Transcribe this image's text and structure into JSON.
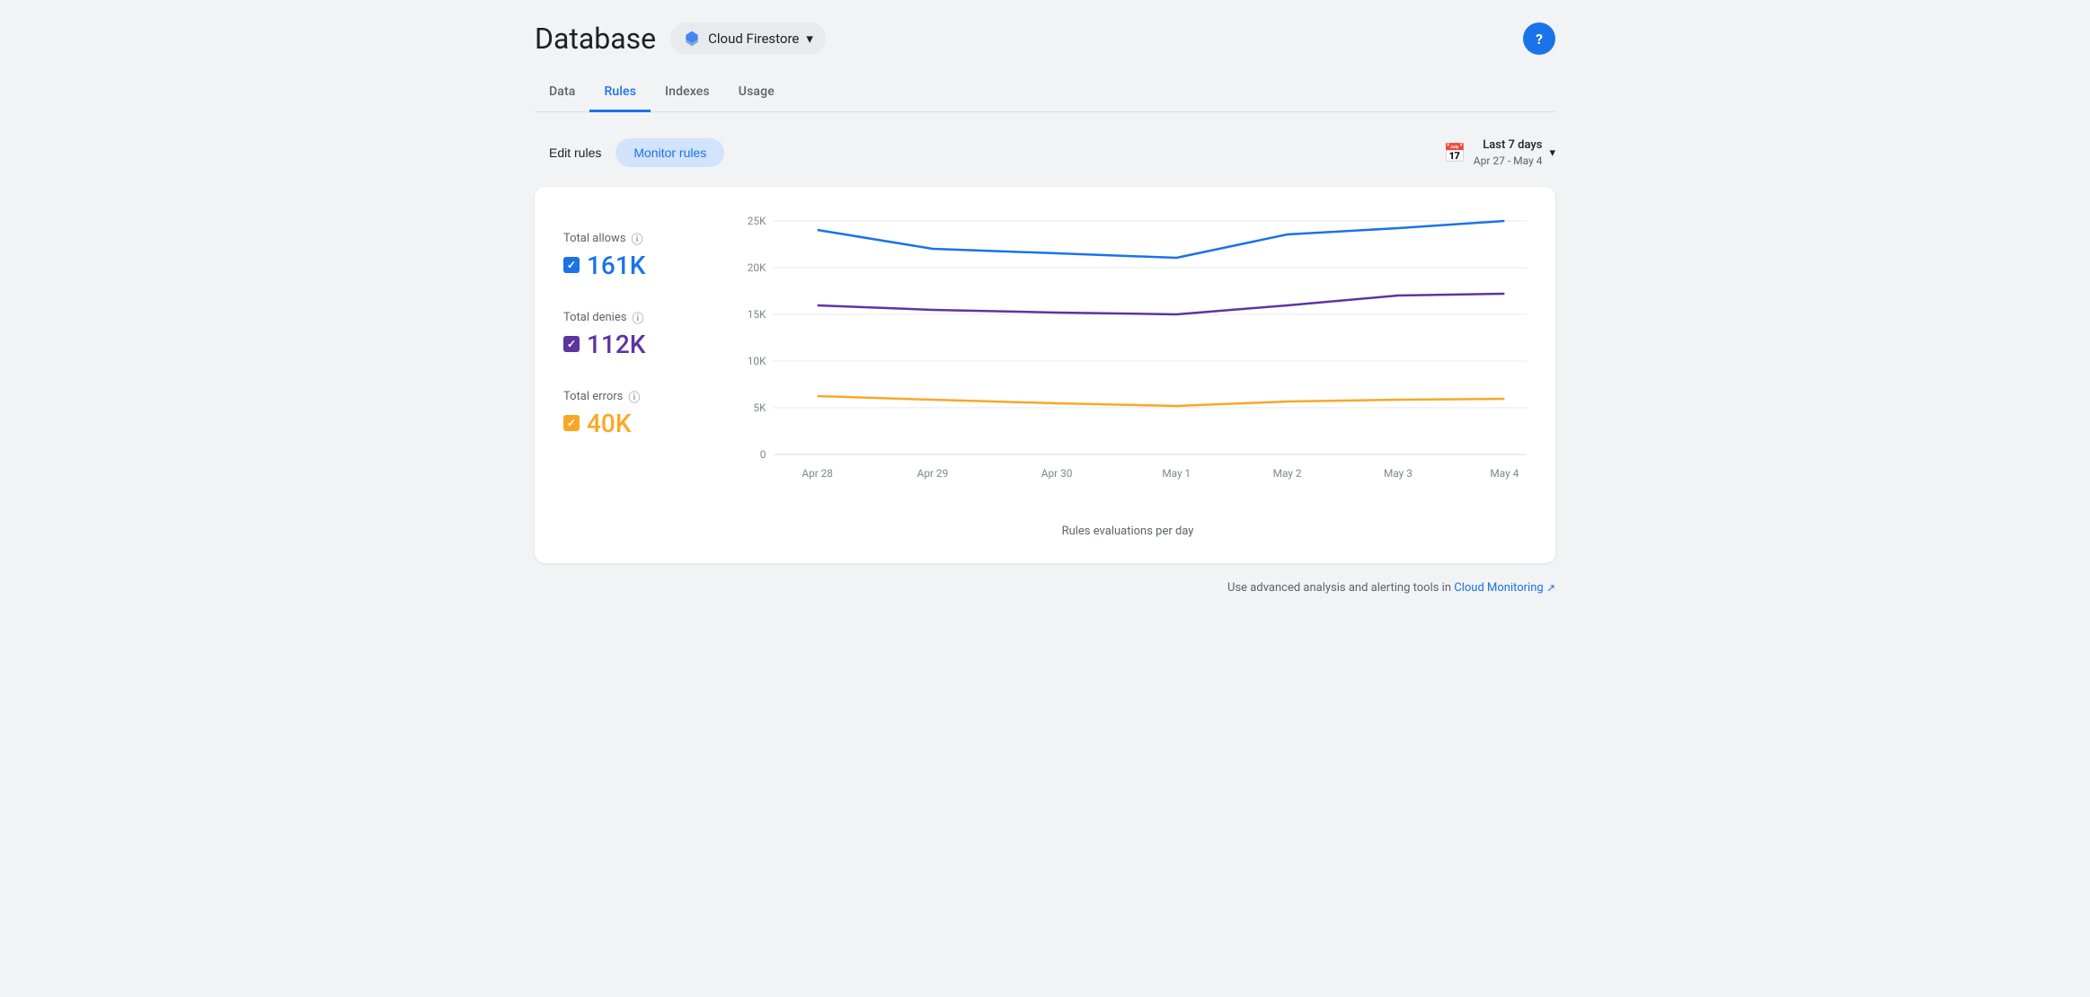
{
  "header": {
    "title": "Database",
    "product": "Cloud Firestore",
    "help_label": "?"
  },
  "nav": {
    "tabs": [
      {
        "label": "Data",
        "active": false
      },
      {
        "label": "Rules",
        "active": true
      },
      {
        "label": "Indexes",
        "active": false
      },
      {
        "label": "Usage",
        "active": false
      }
    ]
  },
  "toolbar": {
    "edit_rules_label": "Edit rules",
    "monitor_rules_label": "Monitor rules"
  },
  "date_range": {
    "label": "Last 7 days",
    "range": "Apr 27 - May 4"
  },
  "chart": {
    "title": "Rules evaluations per day",
    "metrics": [
      {
        "label": "Total allows",
        "value": "161K",
        "color": "blue",
        "color_hex": "#1a73e8"
      },
      {
        "label": "Total denies",
        "value": "112K",
        "color": "purple",
        "color_hex": "#5c35a0"
      },
      {
        "label": "Total errors",
        "value": "40K",
        "color": "yellow",
        "color_hex": "#f9a825"
      }
    ],
    "y_axis": [
      "25K",
      "20K",
      "15K",
      "10K",
      "5K",
      "0"
    ],
    "x_axis": [
      "Apr 28",
      "Apr 29",
      "Apr 30",
      "May 1",
      "May 2",
      "May 3",
      "May 4"
    ],
    "series": {
      "allows": [
        24000,
        22000,
        21500,
        21000,
        23500,
        24200,
        25000
      ],
      "denies": [
        16000,
        15500,
        15200,
        15000,
        16000,
        17000,
        17200
      ],
      "errors": [
        6200,
        5900,
        5500,
        5200,
        5700,
        5900,
        6000
      ]
    }
  },
  "footer": {
    "note": "Use advanced analysis and alerting tools in",
    "link_text": "Cloud Monitoring",
    "link_icon": "↗"
  }
}
